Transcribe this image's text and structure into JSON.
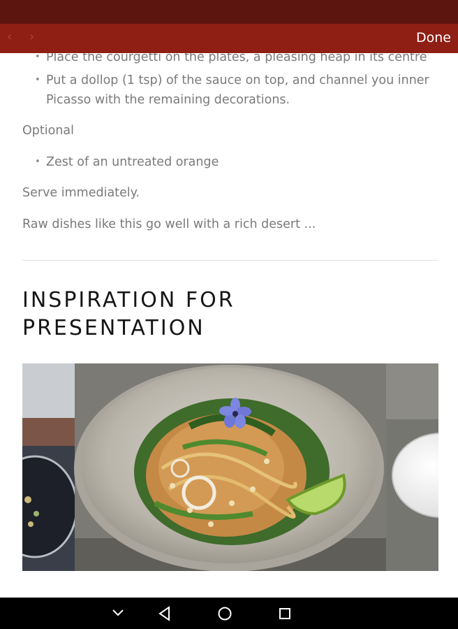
{
  "toolbar": {
    "back_icon": "back-arrow-icon",
    "forward_icon": "forward-arrow-icon",
    "done_label": "Done"
  },
  "article": {
    "bullets_top": [
      "Place the courgetti on the plates, a pleasing heap in its centre",
      "Put a dollop (1 tsp) of the sauce on top, and channel you inner Picasso with the remaining decorations."
    ],
    "optional_label": "Optional",
    "optional_items": [
      "Zest of an untreated orange"
    ],
    "serve_text": "Serve immediately.",
    "note_text": "Raw dishes like this go well with a rich desert ..."
  },
  "section": {
    "title": "INSPIRATION FOR PRESENTATION"
  },
  "gallery": {
    "images": [
      "dish-photo-left-partial",
      "courgetti-dish-photo",
      "white-bowl-photo-right-partial"
    ]
  },
  "system_nav": {
    "icons": [
      "chevron-down-icon",
      "back-triangle-icon",
      "home-circle-icon",
      "recents-square-icon"
    ]
  },
  "colors": {
    "status_bar": "#5c150f",
    "toolbar": "#8f1e15",
    "body_text": "#7a7a7a",
    "heading_text": "#151515"
  }
}
